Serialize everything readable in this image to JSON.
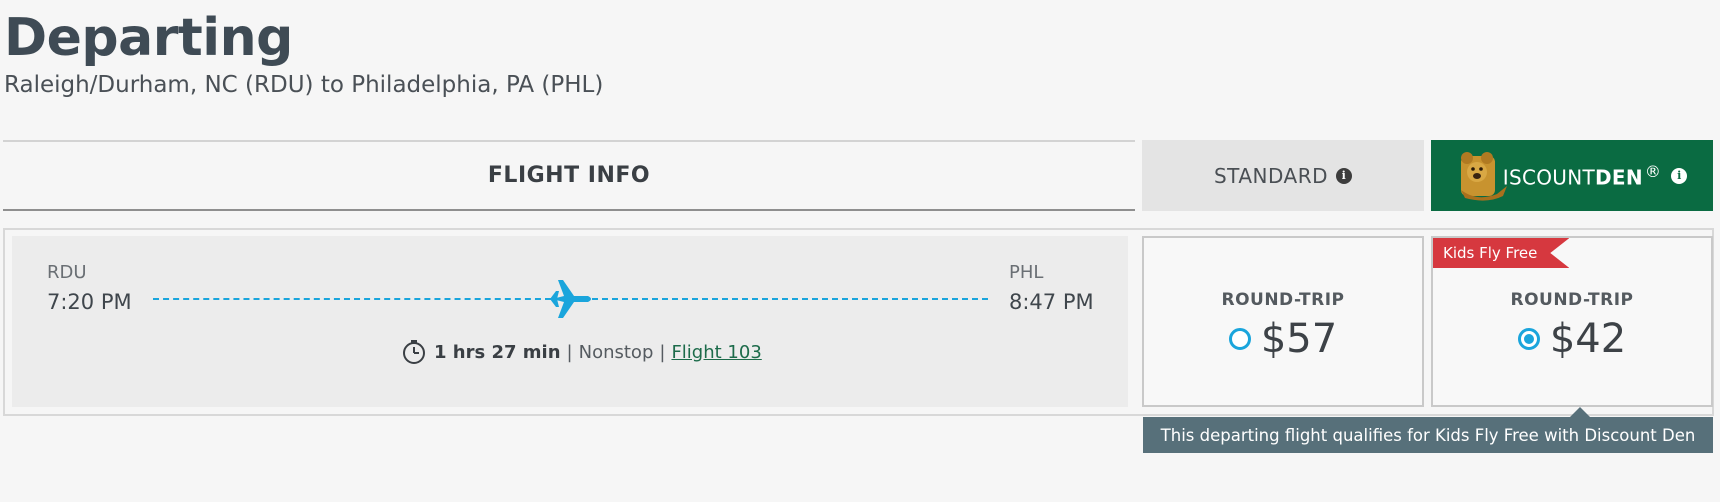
{
  "header": {
    "title": "Departing",
    "route": "Raleigh/Durham, NC (RDU) to Philadelphia, PA (PHL)"
  },
  "columns": {
    "flight_info": "FLIGHT INFO",
    "standard": "STANDARD",
    "discount_den": {
      "text_light": "ISCOUNT",
      "text_bold": "DEN",
      "reg_mark": "®"
    }
  },
  "flight": {
    "origin_code": "RDU",
    "depart_time": "7:20 PM",
    "dest_code": "PHL",
    "arrive_time": "8:47 PM",
    "duration": "1 hrs 27 min",
    "stops": "Nonstop",
    "separator": "|",
    "flight_link": "Flight 103"
  },
  "fares": {
    "standard": {
      "label": "ROUND-TRIP",
      "price": "$57",
      "selected": false
    },
    "discount_den": {
      "label": "ROUND-TRIP",
      "price": "$42",
      "selected": true,
      "ribbon": "Kids Fly Free"
    }
  },
  "tooltip": "This departing flight qualifies for Kids Fly Free with Discount Den",
  "colors": {
    "accent": "#1aa5dc",
    "den_green": "#0a6b42",
    "ribbon_red": "#d6383f",
    "tooltip_bg": "#57707a"
  }
}
